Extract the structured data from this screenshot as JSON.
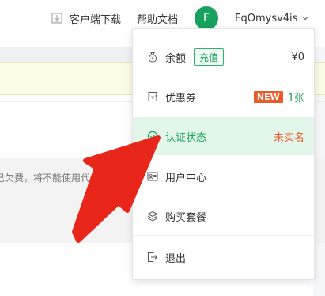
{
  "header": {
    "download_label": "客户端下载",
    "docs_label": "帮助文档",
    "avatar_letter": "F",
    "username": "FqOmysv4is"
  },
  "background": {
    "notice_text": "已欠费，将不能使用代"
  },
  "menu": {
    "balance": {
      "label": "余额",
      "charge_label": "充值",
      "value": "¥0"
    },
    "coupons": {
      "label": "优惠券",
      "badge": "NEW",
      "count": "1张"
    },
    "verify": {
      "label": "认证状态",
      "status": "未实名"
    },
    "user_center": {
      "label": "用户中心"
    },
    "buy_plan": {
      "label": "购买套餐"
    },
    "logout": {
      "label": "退出"
    }
  },
  "colors": {
    "accent_green": "#19a15f",
    "status_orange": "#ea5b2c",
    "annotation_red": "#e8271a"
  }
}
